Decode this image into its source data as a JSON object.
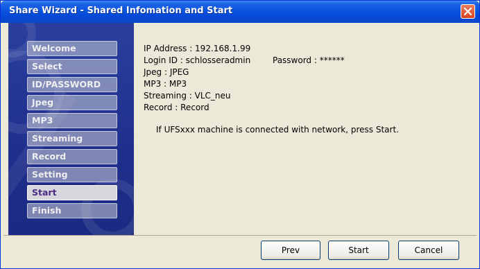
{
  "window": {
    "title": "Share Wizard - Shared Infomation and Start",
    "close_icon": "close-x-icon",
    "colors": {
      "title_bar": "#0549d6",
      "sidebar": "#1f2f8c",
      "body": "#ece9d8",
      "active_step_text": "#4b2a84"
    }
  },
  "sidebar": {
    "steps": [
      {
        "label": "Welcome",
        "active": false
      },
      {
        "label": "Select",
        "active": false
      },
      {
        "label": "ID/PASSWORD",
        "active": false
      },
      {
        "label": "Jpeg",
        "active": false
      },
      {
        "label": "MP3",
        "active": false
      },
      {
        "label": "Streaming",
        "active": false
      },
      {
        "label": "Record",
        "active": false
      },
      {
        "label": "Setting",
        "active": false
      },
      {
        "label": "Start",
        "active": true
      },
      {
        "label": "Finish",
        "active": false
      }
    ]
  },
  "info": {
    "ip_address": "IP Address : 192.168.1.99",
    "login_id": "Login ID : schlosseradmin",
    "password": "Password : ******",
    "jpeg": "Jpeg : JPEG",
    "mp3": "MP3 : MP3",
    "streaming": "Streaming : VLC_neu",
    "record": "Record : Record",
    "start_message": "If UFSxxx machine is connected with network, press Start."
  },
  "buttons": {
    "prev": "Prev",
    "start": "Start",
    "cancel": "Cancel"
  }
}
